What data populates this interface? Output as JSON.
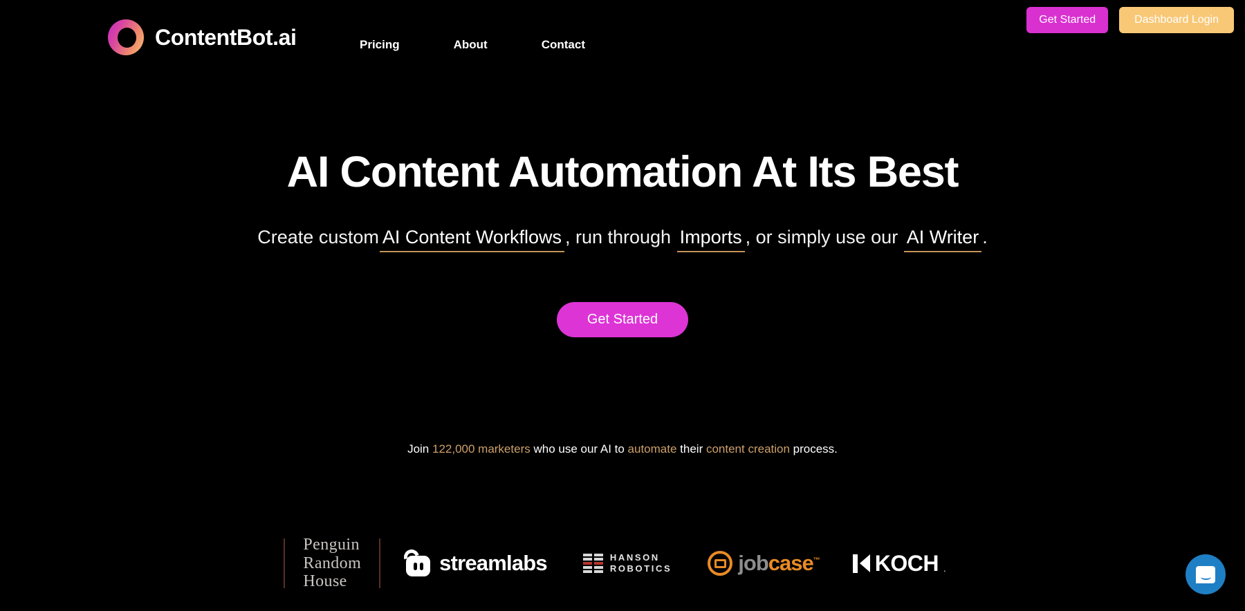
{
  "site": {
    "background_color": "#000000",
    "accent_magenta": "#d930d0",
    "accent_peach": "#f8c877",
    "accent_tan": "#c4955a"
  },
  "header": {
    "brand_name": "ContentBot.ai",
    "logo_icon": "gradient-ring-icon",
    "nav": [
      {
        "label": "Pricing"
      },
      {
        "label": "About"
      },
      {
        "label": "Contact"
      }
    ],
    "buttons": {
      "get_started": "Get Started",
      "dashboard_login": "Dashboard Login"
    }
  },
  "hero": {
    "headline": "AI Content Automation At Its Best",
    "subhead": {
      "part1": "Create custom",
      "link1": "AI Content Workflows",
      "part2": ", run through ",
      "link2": "Imports",
      "part3": ", or simply use our ",
      "link3": "AI Writer",
      "part4": "."
    },
    "cta_label": "Get Started"
  },
  "social_proof": {
    "prefix": "Join ",
    "highlight1": "122,000 marketers",
    "middle1": " who use our AI to ",
    "highlight2": "automate",
    "middle2": " their ",
    "highlight3": "content creation",
    "suffix": " process."
  },
  "logos": [
    {
      "name": "Penguin Random House",
      "line1": "Penguin",
      "line2": "Random",
      "line3": "House"
    },
    {
      "name": "streamlabs",
      "wordmark": "streamlabs"
    },
    {
      "name": "Hanson Robotics",
      "line1": "HANSON",
      "line2": "ROBOTICS"
    },
    {
      "name": "jobcase",
      "part1": "job",
      "part2": "case",
      "tm": "™"
    },
    {
      "name": "KOCH",
      "wordmark": "KOCH",
      "suffix": "."
    }
  ],
  "chat": {
    "icon": "chat-bubble-icon",
    "color": "#1f7fc4"
  }
}
